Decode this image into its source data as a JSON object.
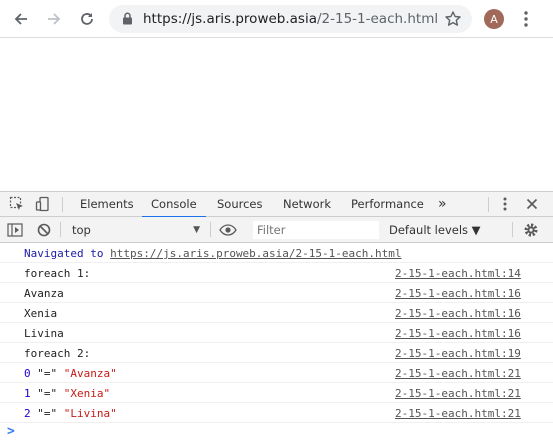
{
  "browser": {
    "url_host": "https://js.aris.proweb.asia",
    "url_path": "/2-15-1-each.html",
    "avatar_letter": "A"
  },
  "devtools": {
    "tabs": [
      "Elements",
      "Console",
      "Sources",
      "Network",
      "Performance"
    ],
    "active_tab": "Console",
    "more_tabs": "»",
    "context": "top",
    "filter_placeholder": "Filter",
    "levels_label": "Default levels ▼",
    "accent": "#1a73e8"
  },
  "console": {
    "navigated": {
      "prefix": "Navigated to",
      "url": "https://js.aris.proweb.asia/2-15-1-each.html"
    },
    "messages": [
      {
        "text": "foreach 1:",
        "source": "2-15-1-each.html:14"
      },
      {
        "text": "Avanza",
        "source": "2-15-1-each.html:16"
      },
      {
        "text": "Xenia",
        "source": "2-15-1-each.html:16"
      },
      {
        "text": "Livina",
        "source": "2-15-1-each.html:16"
      },
      {
        "text": "foreach 2:",
        "source": "2-15-1-each.html:19"
      }
    ],
    "pairs": [
      {
        "index": "0",
        "sep": "\"=\"",
        "value": "\"Avanza\"",
        "source": "2-15-1-each.html:21"
      },
      {
        "index": "1",
        "sep": "\"=\"",
        "value": "\"Xenia\"",
        "source": "2-15-1-each.html:21"
      },
      {
        "index": "2",
        "sep": "\"=\"",
        "value": "\"Livina\"",
        "source": "2-15-1-each.html:21"
      }
    ],
    "prompt": ">"
  }
}
